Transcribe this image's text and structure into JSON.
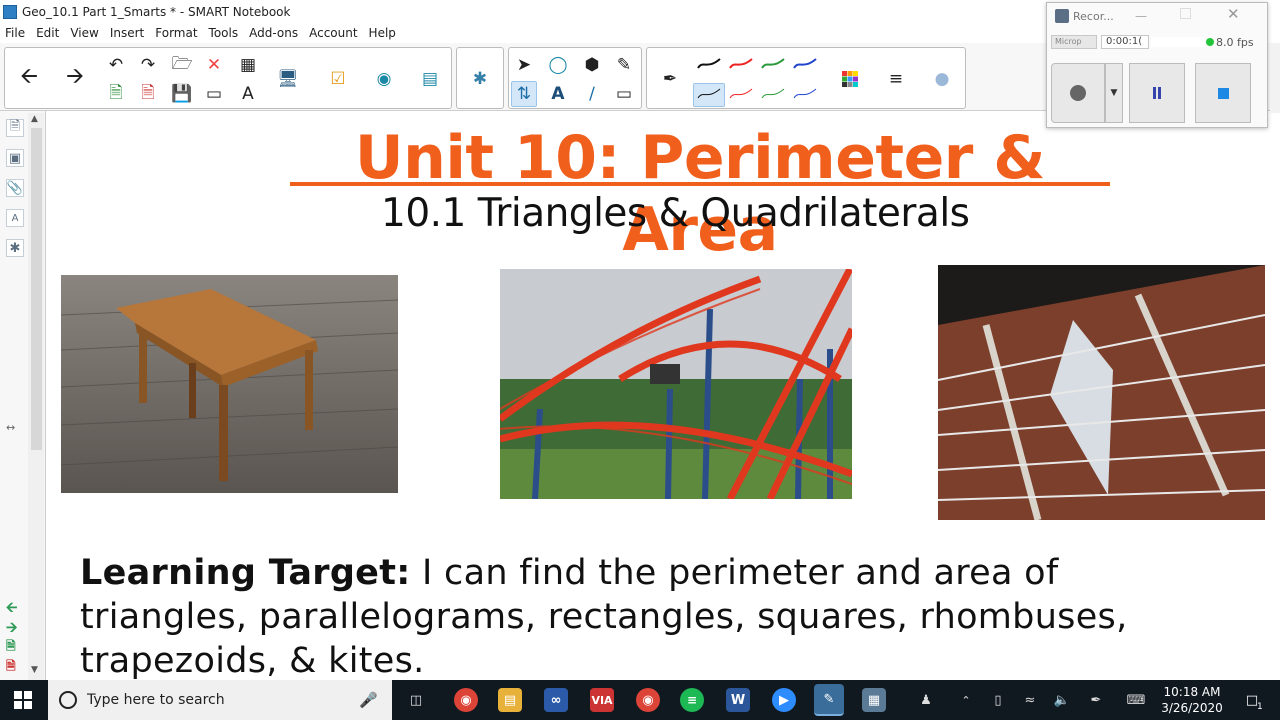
{
  "window": {
    "title": "Geo_10.1 Part 1_Smarts * - SMART Notebook"
  },
  "menu": {
    "items": [
      "File",
      "Edit",
      "View",
      "Insert",
      "Format",
      "Tools",
      "Add-ons",
      "Account",
      "Help"
    ]
  },
  "recorder": {
    "title": "Recor...",
    "source": "Microp",
    "time": "0:00:1(",
    "fps": "8.0 fps",
    "colors": {
      "indicator": "#22c43a",
      "stop": "#1e88e5",
      "pause": "#3344aa"
    }
  },
  "slide": {
    "title": "Unit 10: Perimeter & Area",
    "subtitle": "10.1 Triangles & Quadrilaterals",
    "learning_target_label": "Learning Target:",
    "learning_target_text": " I can find the perimeter and area of triangles, parallelograms, rectangles, squares, rhombuses, trapezoids, & kites.",
    "title_color": "#f15f1d",
    "images": [
      {
        "name": "trapezoid-table-photo"
      },
      {
        "name": "roller-coaster-photo"
      },
      {
        "name": "guitar-fret-inlay-photo"
      }
    ]
  },
  "taskbar": {
    "search_placeholder": "Type here to search",
    "time": "10:18 AM",
    "date": "3/26/2020",
    "notification_count": "1"
  }
}
